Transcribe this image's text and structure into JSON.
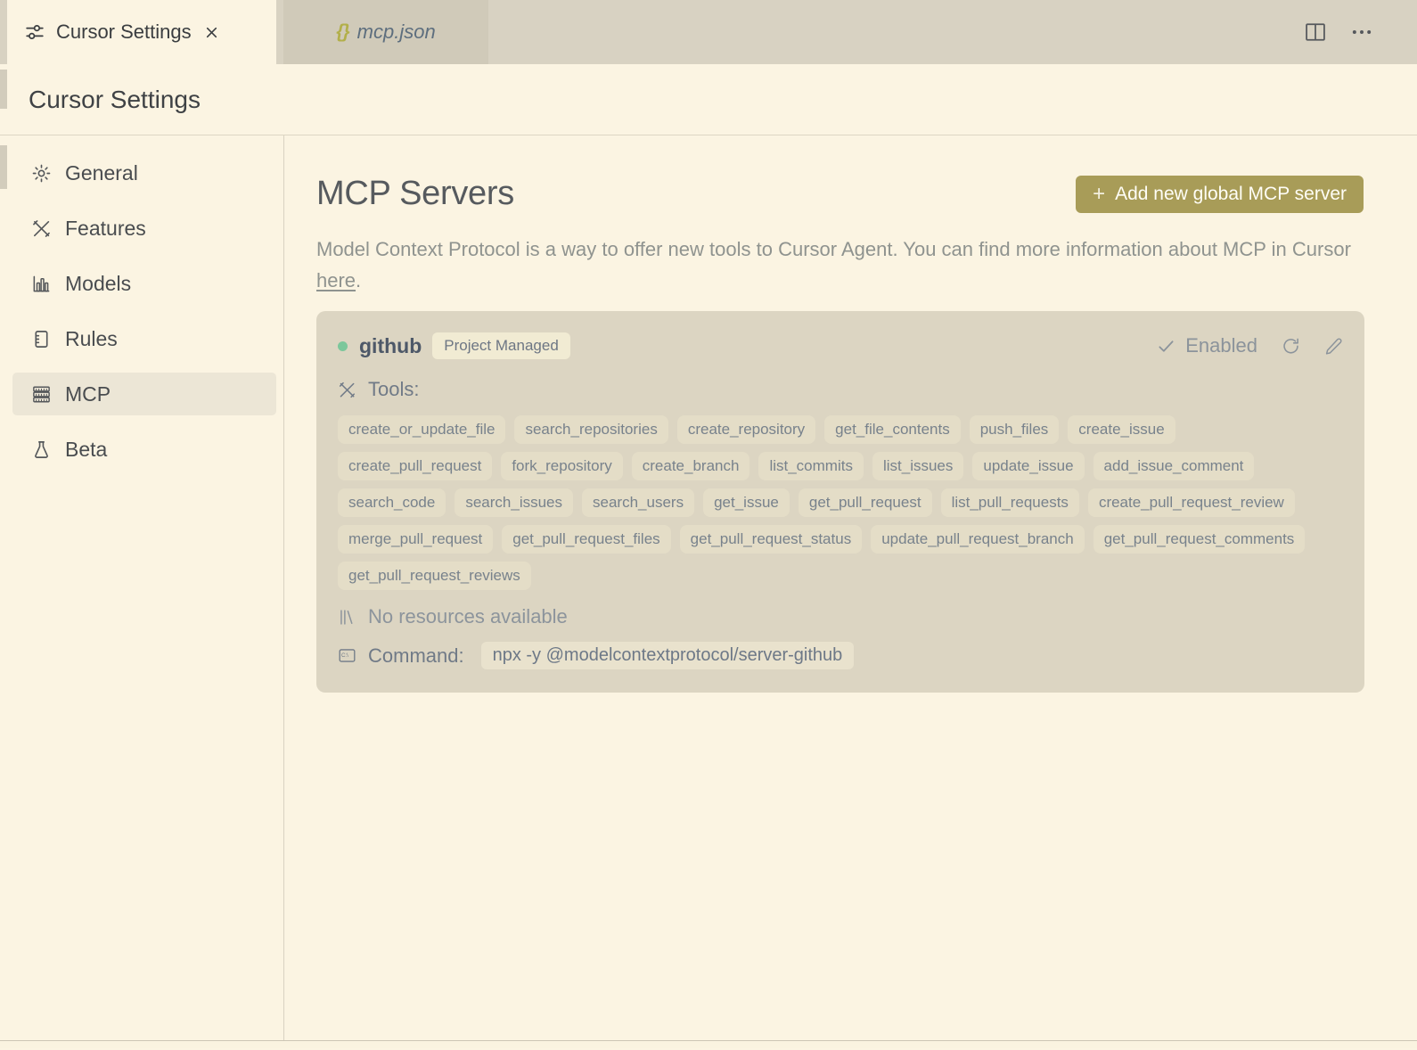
{
  "window": {
    "tab_bar": {
      "tabs": [
        {
          "label": "Cursor Settings"
        },
        {
          "label": "mcp.json",
          "icon_glyph": "{}"
        }
      ]
    }
  },
  "page": {
    "title": "Cursor Settings"
  },
  "sidebar": {
    "items": [
      {
        "label": "General"
      },
      {
        "label": "Features"
      },
      {
        "label": "Models"
      },
      {
        "label": "Rules"
      },
      {
        "label": "MCP"
      },
      {
        "label": "Beta"
      }
    ]
  },
  "main": {
    "heading": "MCP Servers",
    "add_button": {
      "plus": "+",
      "label": "Add new global MCP server"
    },
    "description": {
      "before": "Model Context Protocol is a way to offer new tools to Cursor Agent. You can find more information about MCP in Cursor ",
      "link_text": "here",
      "after": "."
    },
    "server_card": {
      "name": "github",
      "badge": "Project Managed",
      "status_label": "Enabled",
      "tools_label": "Tools:",
      "tools": [
        "create_or_update_file",
        "search_repositories",
        "create_repository",
        "get_file_contents",
        "push_files",
        "create_issue",
        "create_pull_request",
        "fork_repository",
        "create_branch",
        "list_commits",
        "list_issues",
        "update_issue",
        "add_issue_comment",
        "search_code",
        "search_issues",
        "search_users",
        "get_issue",
        "get_pull_request",
        "list_pull_requests",
        "create_pull_request_review",
        "merge_pull_request",
        "get_pull_request_files",
        "get_pull_request_status",
        "update_pull_request_branch",
        "get_pull_request_comments",
        "get_pull_request_reviews"
      ],
      "resources_text": "No resources available",
      "command_label": "Command:",
      "command_value": "npx -y @modelcontextprotocol/server-github"
    }
  },
  "colors": {
    "accent_button": "#a89c58",
    "status_dot_green": "#7cc79b",
    "json_braces_olive": "#b2af49",
    "card_background": "#dcd5c2",
    "page_background": "#fbf4e2"
  }
}
